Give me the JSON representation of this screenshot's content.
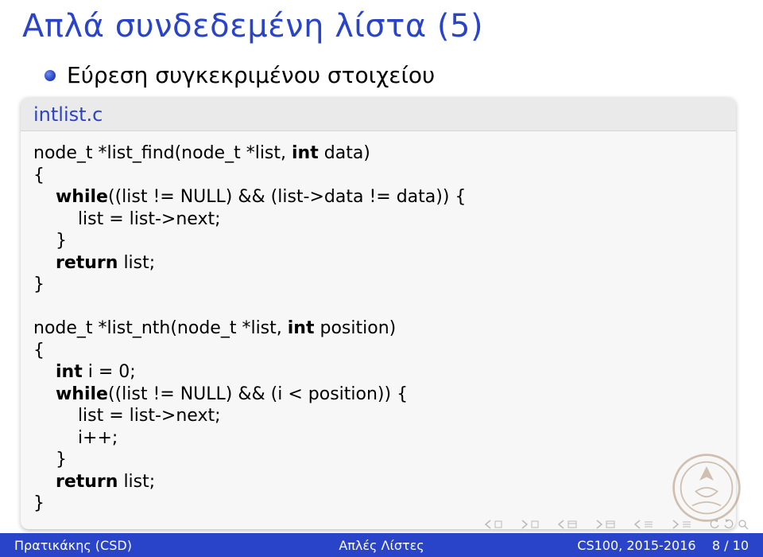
{
  "title": "Απλά συνδεδεμένη λίστα (5)",
  "bullet": "Εύρεση συγκεκριμένου στοιχείου",
  "code": {
    "header": "intlist.c",
    "l1a": "node_t *list_find(node_t *list, ",
    "l1b": "int",
    "l1c": " data)",
    "l2": "{",
    "l3a": "    ",
    "l3b": "while",
    "l3c": "((list != NULL) && (list->data != data)) {",
    "l4": "        list = list->next;",
    "l5": "    }",
    "l6a": "    ",
    "l6b": "return",
    "l6c": " list;",
    "l7": "}",
    "l9a": "node_t *list_nth(node_t *list, ",
    "l9b": "int",
    "l9c": " position)",
    "l10": "{",
    "l11a": "    ",
    "l11b": "int",
    "l11c": " i = 0;",
    "l12a": "    ",
    "l12b": "while",
    "l12c": "((list != NULL) && (i < position)) {",
    "l13": "        list = list->next;",
    "l14": "        i++;",
    "l15": "    }",
    "l16a": "    ",
    "l16b": "return",
    "l16c": " list;",
    "l17": "}"
  },
  "footer": {
    "left": "Πρατικάκης (CSD)",
    "center": "Απλές Λίστες",
    "right": "CS100, 2015-2016",
    "page": "8 / 10"
  }
}
